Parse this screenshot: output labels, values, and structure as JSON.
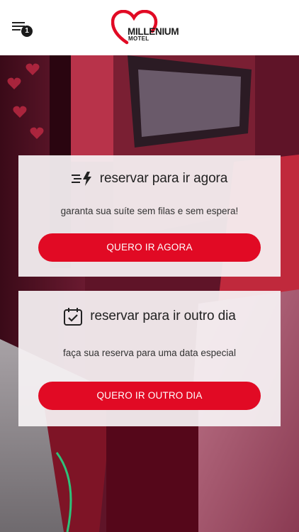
{
  "header": {
    "menu_badge": "1",
    "logo_name": "MILLENIUM",
    "logo_sub": "MOTEL",
    "brand_color": "#e10a24"
  },
  "cards": [
    {
      "icon": "speed-lightning-icon",
      "title": "reservar para ir agora",
      "subtitle": "garanta sua suíte sem filas e sem espera!",
      "button": "QUERO IR AGORA"
    },
    {
      "icon": "calendar-check-icon",
      "title": "reservar para ir outro dia",
      "subtitle": "faça sua reserva para uma data especial",
      "button": "QUERO IR OUTRO DIA"
    }
  ]
}
